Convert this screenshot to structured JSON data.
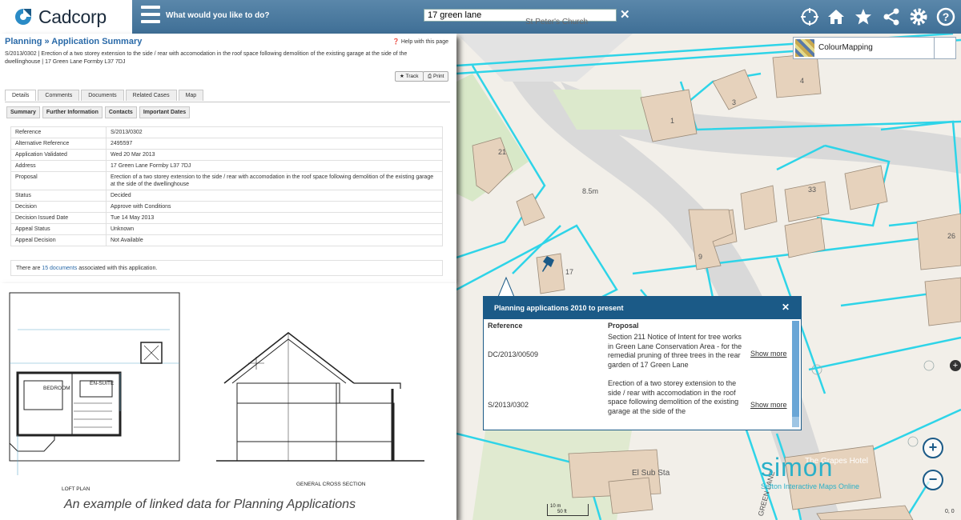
{
  "app": {
    "logo_text": "Cadcorp",
    "question": "What would you like to do?",
    "search_value": "17 green lane",
    "clear_icon": "close-icon"
  },
  "toolbar": {
    "icons": [
      "crosshair-icon",
      "home-icon",
      "star-icon",
      "share-icon",
      "gear-icon",
      "help-icon"
    ]
  },
  "layer": {
    "label": "ColourMapping"
  },
  "planning": {
    "breadcrumb": "Planning » Application Summary",
    "help": "Help with this page",
    "description": "S/2013/0302 | Erection of a two storey extension to the side / rear with accomodation in the roof space following demolition of the existing garage at the side of the dwellinghouse | 17 Green Lane Formby L37 7DJ",
    "track": "Track",
    "print": "Print",
    "tabs": [
      "Details",
      "Comments",
      "Documents",
      "Related Cases",
      "Map"
    ],
    "subtabs": [
      "Summary",
      "Further Information",
      "Contacts",
      "Important Dates"
    ],
    "rows": [
      {
        "k": "Reference",
        "v": "S/2013/0302"
      },
      {
        "k": "Alternative Reference",
        "v": "2495597"
      },
      {
        "k": "Application Validated",
        "v": "Wed 20 Mar 2013"
      },
      {
        "k": "Address",
        "v": "17 Green Lane Formby L37 7DJ"
      },
      {
        "k": "Proposal",
        "v": "Erection of a two storey extension to the side / rear with accomodation in the roof space following demolition of the existing garage at the side of the dwellinghouse"
      },
      {
        "k": "Status",
        "v": "Decided"
      },
      {
        "k": "Decision",
        "v": "Approve with Conditions"
      },
      {
        "k": "Decision Issued Date",
        "v": "Tue 14 May 2013"
      },
      {
        "k": "Appeal Status",
        "v": "Unknown"
      },
      {
        "k": "Appeal Decision",
        "v": "Not Available"
      }
    ],
    "docs_pre": "There are ",
    "docs_link": "15 documents",
    "docs_post": " associated with this application."
  },
  "drawing": {
    "loft_label": "LOFT PLAN",
    "section_label": "GENERAL CROSS SECTION",
    "bedroom": "BEDROOM",
    "ensuite": "EN-SUITE",
    "caption": "An example of linked data for Planning Applications"
  },
  "popup": {
    "title": "Planning applications 2010 to present",
    "col_ref": "Reference",
    "col_prop": "Proposal",
    "items": [
      {
        "ref": "DC/2013/00509",
        "proposal": "Section 211 Notice of Intent for tree works in Green Lane Conservation Area - for the remedial pruning of three trees in the rear garden of 17 Green Lane",
        "link": "Show more"
      },
      {
        "ref": "S/2013/0302",
        "proposal": "Erection of a two storey extension to the side / rear with accomodation in the roof space following demolition of the existing garage at the side of the",
        "link": "Show more"
      }
    ]
  },
  "map": {
    "church": "St Peter's Church",
    "distance": "8.5m",
    "el_sub": "El Sub Sta",
    "grapes": "The Grapes Hotel",
    "road": "GREEN LANE",
    "house_numbers": [
      "1",
      "3",
      "4",
      "21",
      "33",
      "9",
      "26",
      "17"
    ],
    "scale_m": "10 m",
    "scale_ft": "50 ft",
    "coords": "0, 0",
    "zoom_in": "+",
    "zoom_out": "−",
    "expand": "+"
  },
  "brand": {
    "name": "simon",
    "tagline": "Sefton Interactive Maps Online"
  },
  "colors": {
    "topbar": "#4a7aa0",
    "popup_header": "#1b5a87",
    "parcel": "#2ed4e8",
    "brand": "#2bb0c8"
  }
}
